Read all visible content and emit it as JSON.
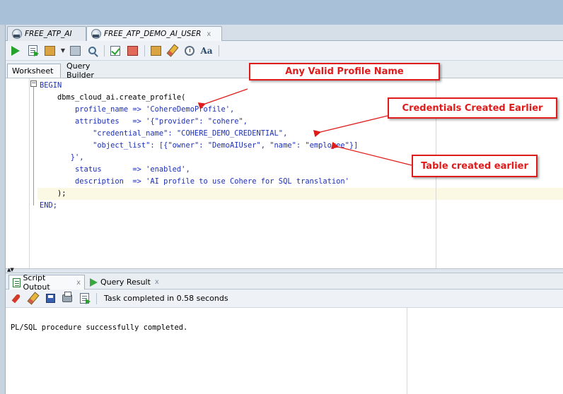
{
  "tabs": [
    {
      "label": "FREE_ATP_AI",
      "active": false
    },
    {
      "label": "FREE_ATP_DEMO_AI_USER",
      "active": true
    }
  ],
  "tab_close_glyph": "x",
  "toolbar": {
    "icons": [
      "run-statement-icon",
      "run-script-icon",
      "commit-icon",
      "dropdown-caret-icon",
      "rollback-icon",
      "autotrace-icon",
      "explain-plan-icon",
      "clear-icon",
      "sql-tuning-icon",
      "history-icon",
      "format-icon",
      "uppercase-lowercase-icon"
    ]
  },
  "worksheet_tabs": {
    "worksheet": "Worksheet",
    "query_builder": "Query Builder"
  },
  "code_lines": [
    {
      "indent": "",
      "text": "BEGIN",
      "kind": "kw"
    },
    {
      "indent": "    ",
      "text": "dbms_cloud_ai.create_profile(",
      "kind": "blk"
    },
    {
      "indent": "        ",
      "text": "profile_name => 'CohereDemoProfile',",
      "kind": "str"
    },
    {
      "indent": "        ",
      "text": "attributes   => '{\"provider\": \"cohere\",",
      "kind": "str"
    },
    {
      "indent": "            ",
      "text": "\"credential_name\": \"COHERE_DEMO_CREDENTIAL\",",
      "kind": "str"
    },
    {
      "indent": "            ",
      "text": "\"object_list\": [{\"owner\": \"DemoAIUser\", \"name\": \"employee\"}]",
      "kind": "str"
    },
    {
      "indent": "       ",
      "text": "}',",
      "kind": "str"
    },
    {
      "indent": "        ",
      "text": "status       => 'enabled',",
      "kind": "str"
    },
    {
      "indent": "        ",
      "text": "description  => 'AI profile to use Cohere for SQL translation'",
      "kind": "str"
    },
    {
      "indent": "    ",
      "text": ");",
      "kind": "blk"
    },
    {
      "indent": "",
      "text": "END;",
      "kind": "kw"
    }
  ],
  "output_tabs": {
    "script_output": "Script Output",
    "query_result": "Query Result",
    "close_glyph": "x"
  },
  "output_toolbar": {
    "task_message": "Task completed in 0.58 seconds"
  },
  "output_text": "PL/SQL procedure successfully completed.",
  "callouts": {
    "profile_name": "Any Valid Profile Name",
    "credentials": "Credentials Created Earlier",
    "table": "Table created earlier"
  },
  "colors": {
    "keyword_blue": "#1b2fb8",
    "callout_red": "#e01b1b",
    "current_line": "#fbf8e4"
  }
}
